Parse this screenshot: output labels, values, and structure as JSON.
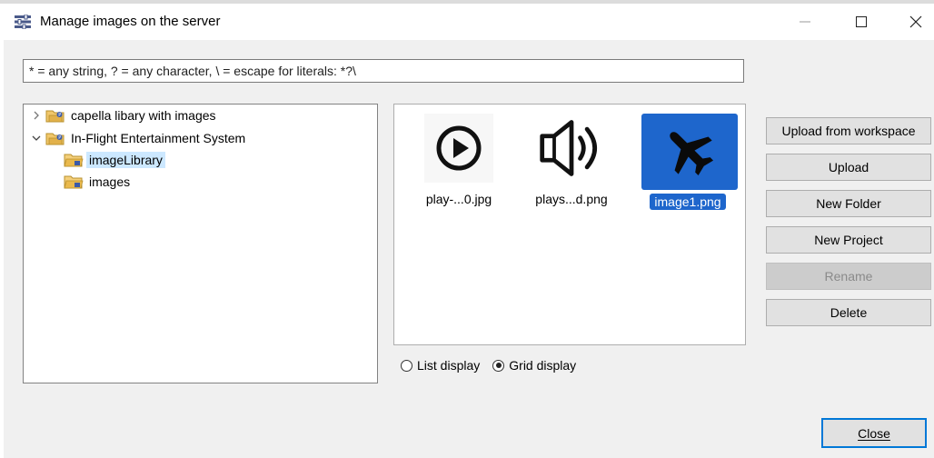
{
  "window": {
    "title": "Manage images on the server",
    "icon": "manage-images-icon"
  },
  "filter": {
    "value": "* = any string, ? = any character, \\ = escape for literals: *?\\"
  },
  "tree": {
    "items": [
      {
        "label": "capella libary with images",
        "expanded": false,
        "selected": false,
        "icon": "project-folder-icon"
      },
      {
        "label": "In-Flight Entertainment System",
        "expanded": true,
        "selected": false,
        "icon": "project-folder-icon"
      },
      {
        "label": "imageLibrary",
        "selected": true,
        "icon": "open-folder-icon"
      },
      {
        "label": "images",
        "selected": false,
        "icon": "open-folder-icon"
      }
    ]
  },
  "gallery": {
    "items": [
      {
        "caption": "play-...0.jpg",
        "icon": "play-circle-icon",
        "selected": false
      },
      {
        "caption": "plays...d.png",
        "icon": "speaker-icon",
        "selected": false
      },
      {
        "caption": "image1.png",
        "icon": "airplane-icon",
        "selected": true
      }
    ]
  },
  "display_mode": {
    "options": [
      {
        "label": "List display",
        "checked": false
      },
      {
        "label": "Grid display",
        "checked": true
      }
    ]
  },
  "actions": {
    "upload_from_workspace": "Upload from workspace",
    "upload": "Upload",
    "new_folder": "New Folder",
    "new_project": "New Project",
    "rename": "Rename",
    "delete": "Delete"
  },
  "footer": {
    "close_label": "Close"
  },
  "colors": {
    "selection": "#1e66cc",
    "tree_selection": "#cce8ff",
    "default_button_border": "#0078d7"
  }
}
